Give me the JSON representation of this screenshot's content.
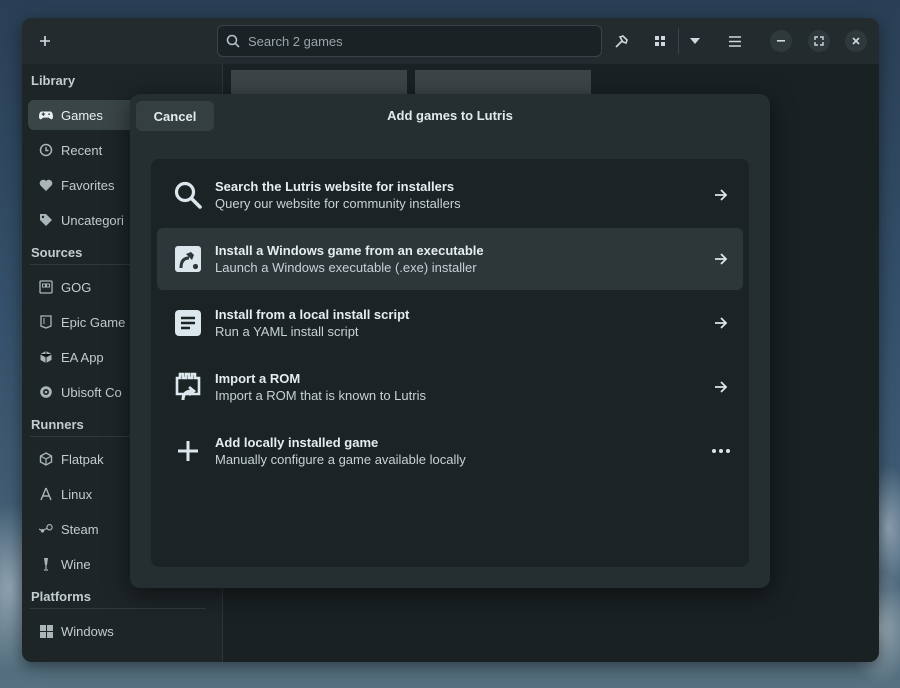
{
  "headerbar": {
    "search_placeholder": "Search 2 games"
  },
  "sidebar": {
    "sections": {
      "library": "Library",
      "sources": "Sources",
      "runners": "Runners",
      "platforms": "Platforms"
    },
    "library_items": [
      {
        "label": "Games",
        "icon": "gamepad-icon",
        "active": true
      },
      {
        "label": "Recent",
        "icon": "clock-icon"
      },
      {
        "label": "Favorites",
        "icon": "heart-icon"
      },
      {
        "label": "Uncategori",
        "icon": "tag-icon"
      }
    ],
    "source_items": [
      {
        "label": "GOG",
        "icon": "gog-icon"
      },
      {
        "label": "Epic Game",
        "icon": "epic-icon"
      },
      {
        "label": "EA App",
        "icon": "ea-icon"
      },
      {
        "label": "Ubisoft Co",
        "icon": "ubisoft-icon"
      }
    ],
    "runner_items": [
      {
        "label": "Flatpak",
        "icon": "flatpak-icon"
      },
      {
        "label": "Linux",
        "icon": "linux-icon"
      },
      {
        "label": "Steam",
        "icon": "steam-icon"
      },
      {
        "label": "Wine",
        "icon": "wine-icon"
      }
    ],
    "platform_items": [
      {
        "label": "Windows",
        "icon": "windows-icon"
      }
    ]
  },
  "dialog": {
    "cancel_label": "Cancel",
    "title": "Add games to Lutris",
    "options": [
      {
        "title": "Search the Lutris website for installers",
        "subtitle": "Query our website for community installers",
        "icon": "search-icon",
        "action": "arrow"
      },
      {
        "title": "Install a Windows game from an executable",
        "subtitle": "Launch a Windows executable (.exe) installer",
        "icon": "windows-exe-icon",
        "action": "arrow",
        "hover": true
      },
      {
        "title": "Install from a local install script",
        "subtitle": "Run a YAML install script",
        "icon": "script-icon",
        "action": "arrow"
      },
      {
        "title": "Import a ROM",
        "subtitle": "Import a ROM that is known to Lutris",
        "icon": "rom-icon",
        "action": "arrow"
      },
      {
        "title": "Add locally installed game",
        "subtitle": "Manually configure a game available locally",
        "icon": "plus-icon",
        "action": "more"
      }
    ]
  },
  "colors": {
    "window_bg": "#1f2628",
    "dialog_bg": "#252e31",
    "list_bg": "#1c2325",
    "accent_text": "#e6edef"
  }
}
